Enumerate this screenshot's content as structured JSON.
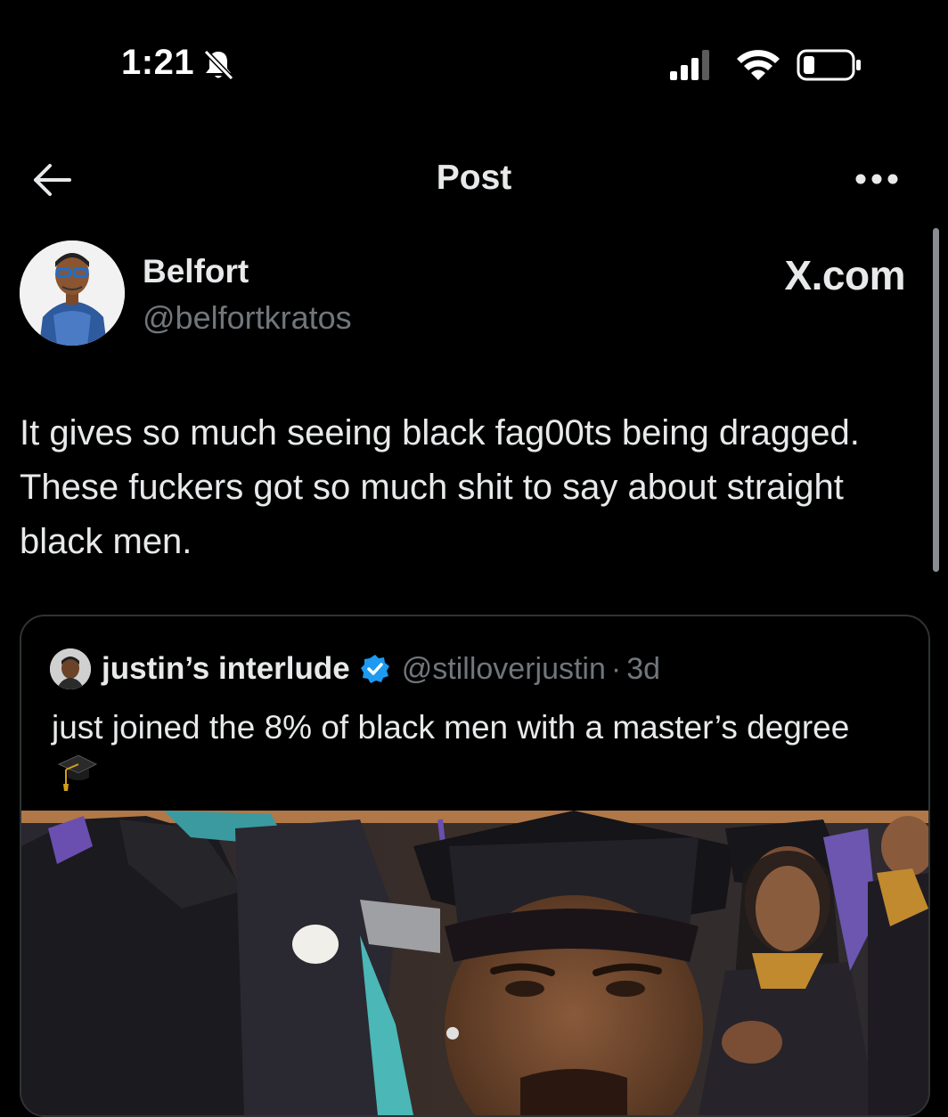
{
  "status_bar": {
    "time": "1:21"
  },
  "nav": {
    "title": "Post"
  },
  "post": {
    "author_name": "Belfort",
    "author_handle": "@belfortkratos",
    "watermark": "X.com",
    "text": "It gives so much seeing black fag00ts being dragged. These fuckers got so much shit to say about straight black men."
  },
  "quoted_post": {
    "author_name": "justin’s interlude",
    "author_handle": "@stilloverjustin",
    "separator": "·",
    "time": "3d",
    "text": "just joined the 8% of black men with a master’s degree"
  },
  "icons": {
    "status": [
      "muted-bell-icon",
      "cellular-signal-icon",
      "wifi-icon",
      "battery-icon"
    ],
    "nav": [
      "back-arrow-icon",
      "more-options-icon"
    ],
    "quote": [
      "verified-badge-icon",
      "graduation-cap-icon"
    ]
  },
  "colors": {
    "background": "#000000",
    "text_primary": "#e7e9ea",
    "text_secondary": "#71767b",
    "border": "#2f3336",
    "verified_blue": "#1d9bf0"
  }
}
